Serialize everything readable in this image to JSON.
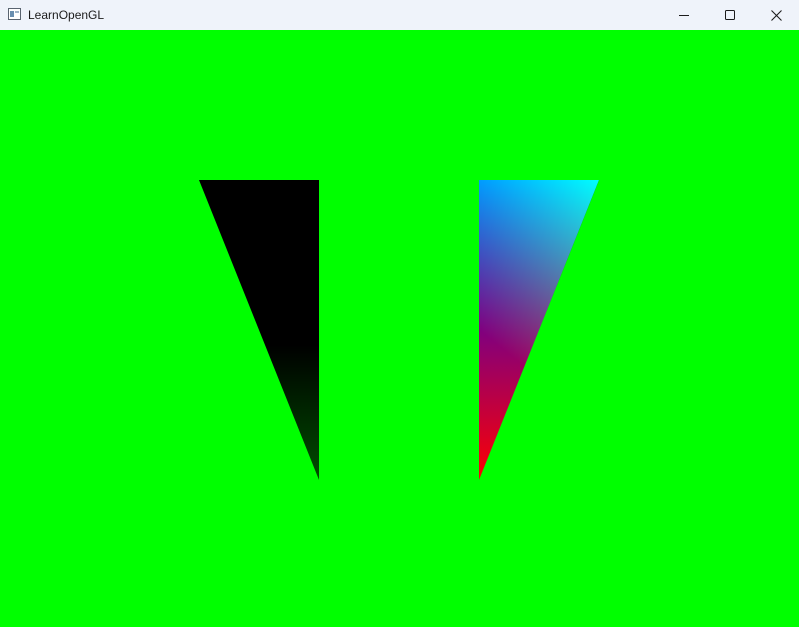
{
  "window": {
    "title": "LearnOpenGL",
    "app_icon": "window-app-icon",
    "controls": [
      {
        "name": "minimize",
        "icon": "minimize-icon"
      },
      {
        "name": "maximize",
        "icon": "maximize-icon"
      },
      {
        "name": "close",
        "icon": "close-icon"
      }
    ]
  },
  "canvas": {
    "clear_color": "#00ff00",
    "triangles": [
      {
        "name": "left-triangle",
        "vertex_colors": [
          "#000000",
          "#000000",
          "#004400"
        ]
      },
      {
        "name": "right-triangle",
        "vertex_colors": [
          "#0000ff",
          "#00ff00",
          "#ff0000"
        ]
      }
    ]
  }
}
